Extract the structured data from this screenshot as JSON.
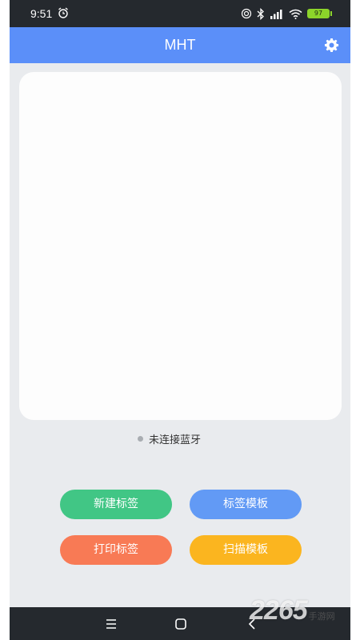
{
  "status_bar": {
    "time": "9:51",
    "battery_level": "97",
    "icons": [
      "alarm-icon",
      "hotspot-icon",
      "bluetooth-icon",
      "signal-icon",
      "wifi-icon",
      "battery-icon"
    ]
  },
  "app_bar": {
    "title": "MHT",
    "settings_icon": "gear-icon"
  },
  "preview": {
    "background": "#fdfdfd"
  },
  "bluetooth": {
    "status_text": "未连接蓝牙",
    "dot_color": "#a9adb2"
  },
  "actions": {
    "new_label": "新建标签",
    "template_label": "标签模板",
    "print_label": "打印标签",
    "scan_label": "扫描模板"
  },
  "colors": {
    "app_bar": "#5b8ff9",
    "new": "#41c685",
    "template": "#629af5",
    "print": "#f87a55",
    "scan": "#fbb51f"
  },
  "nav_bar": {
    "icons": [
      "menu-icon",
      "home-icon",
      "back-icon"
    ]
  },
  "watermark": {
    "number": "2265",
    "suffix": "手游网"
  }
}
